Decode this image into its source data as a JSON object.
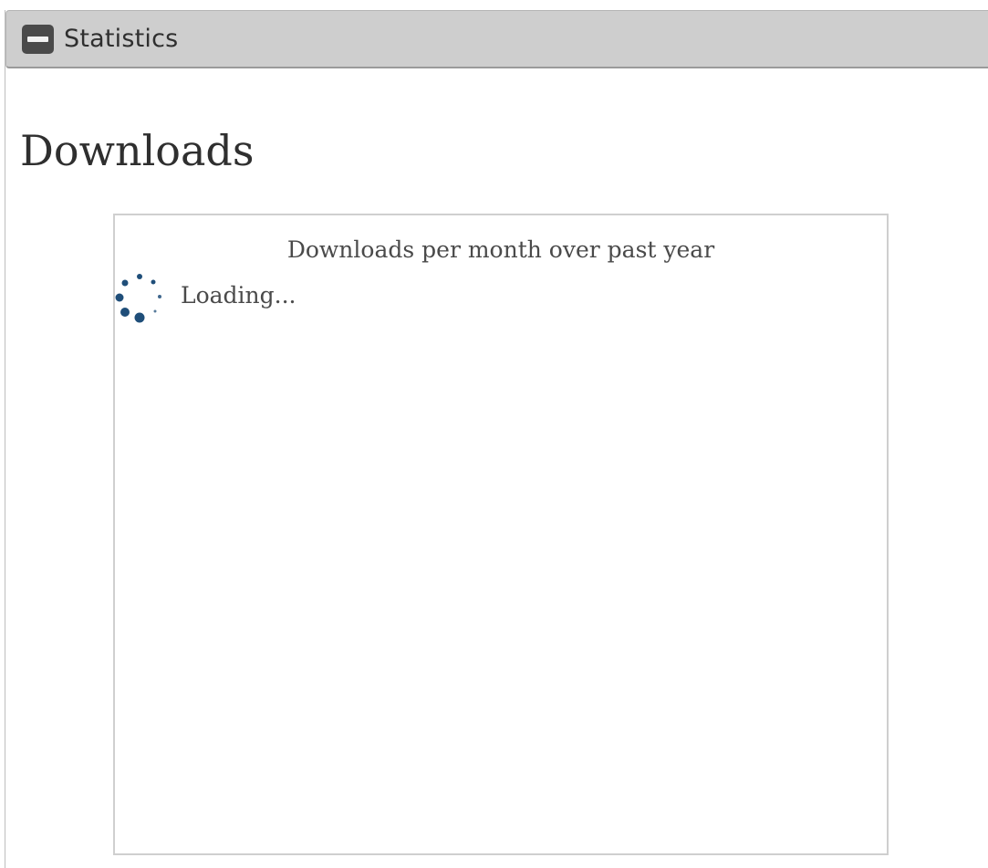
{
  "panel": {
    "title": "Statistics",
    "collapse_icon": "minus-square-icon"
  },
  "section": {
    "heading": "Downloads"
  },
  "chart": {
    "title": "Downloads per month over past year",
    "loading_text": "Loading...",
    "spinner_icon": "loading-spinner-icon",
    "spinner_color": "#1f4e79"
  }
}
